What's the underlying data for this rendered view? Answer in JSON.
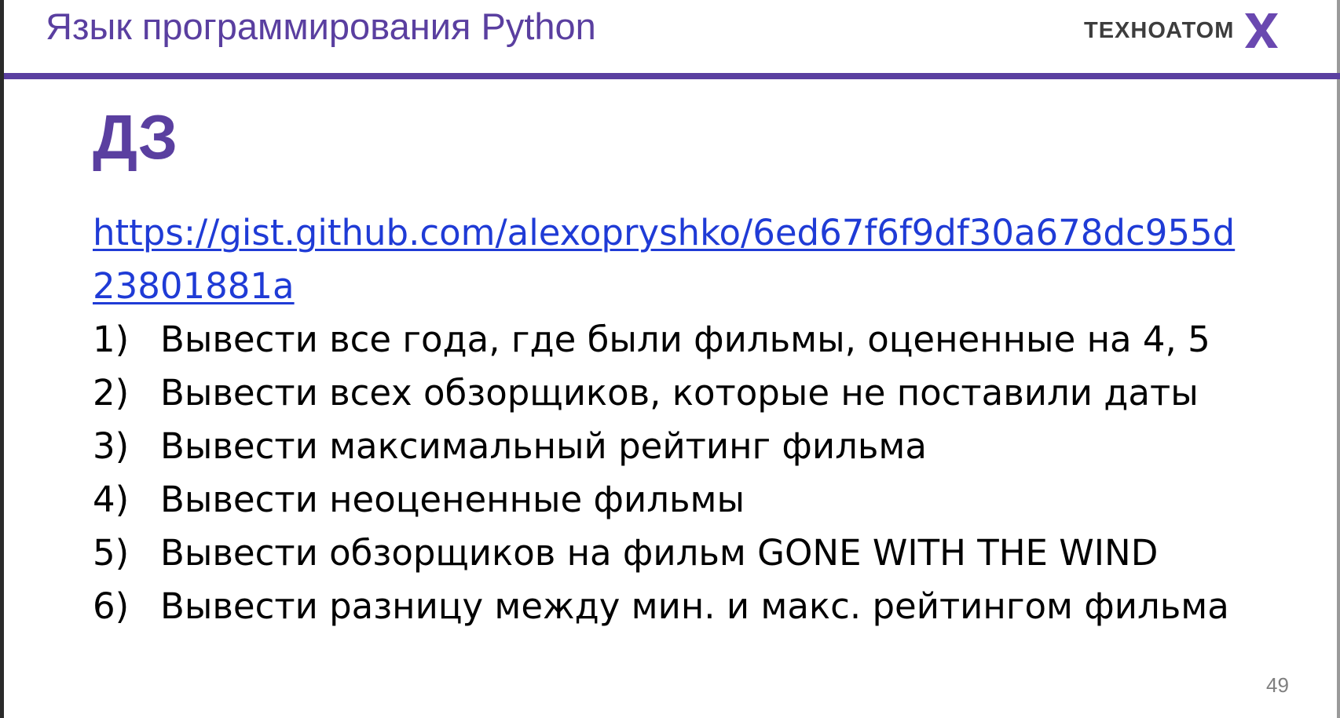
{
  "header": {
    "title": "Язык программирования Python",
    "logo_text": "ТЕХНОАТОМ"
  },
  "heading": "ДЗ",
  "link": {
    "text": "https://gist.github.com/alexopryshko/6ed67f6f9df30a678dc955d23801881a"
  },
  "tasks": [
    {
      "num": "1)",
      "text": "Вывести все года, где были фильмы, оцененные на 4, 5"
    },
    {
      "num": "2)",
      "text": "Вывести всех обзорщиков, которые не поставили даты"
    },
    {
      "num": "3)",
      "text": "Вывести максимальный рейтинг фильма"
    },
    {
      "num": "4)",
      "text": "Вывести неоцененные фильмы"
    },
    {
      "num": "5)",
      "text": "Вывести обзорщиков на фильм GONE WITH THE WIND"
    },
    {
      "num": "6)",
      "text": "Вывести разницу между мин. и макс. рейтингом фильма"
    }
  ],
  "page_number": "49",
  "colors": {
    "accent": "#5a3fa0",
    "link": "#1f3bd6",
    "text": "#000000"
  },
  "icons": {
    "logo_mark": "x-logo-icon"
  }
}
